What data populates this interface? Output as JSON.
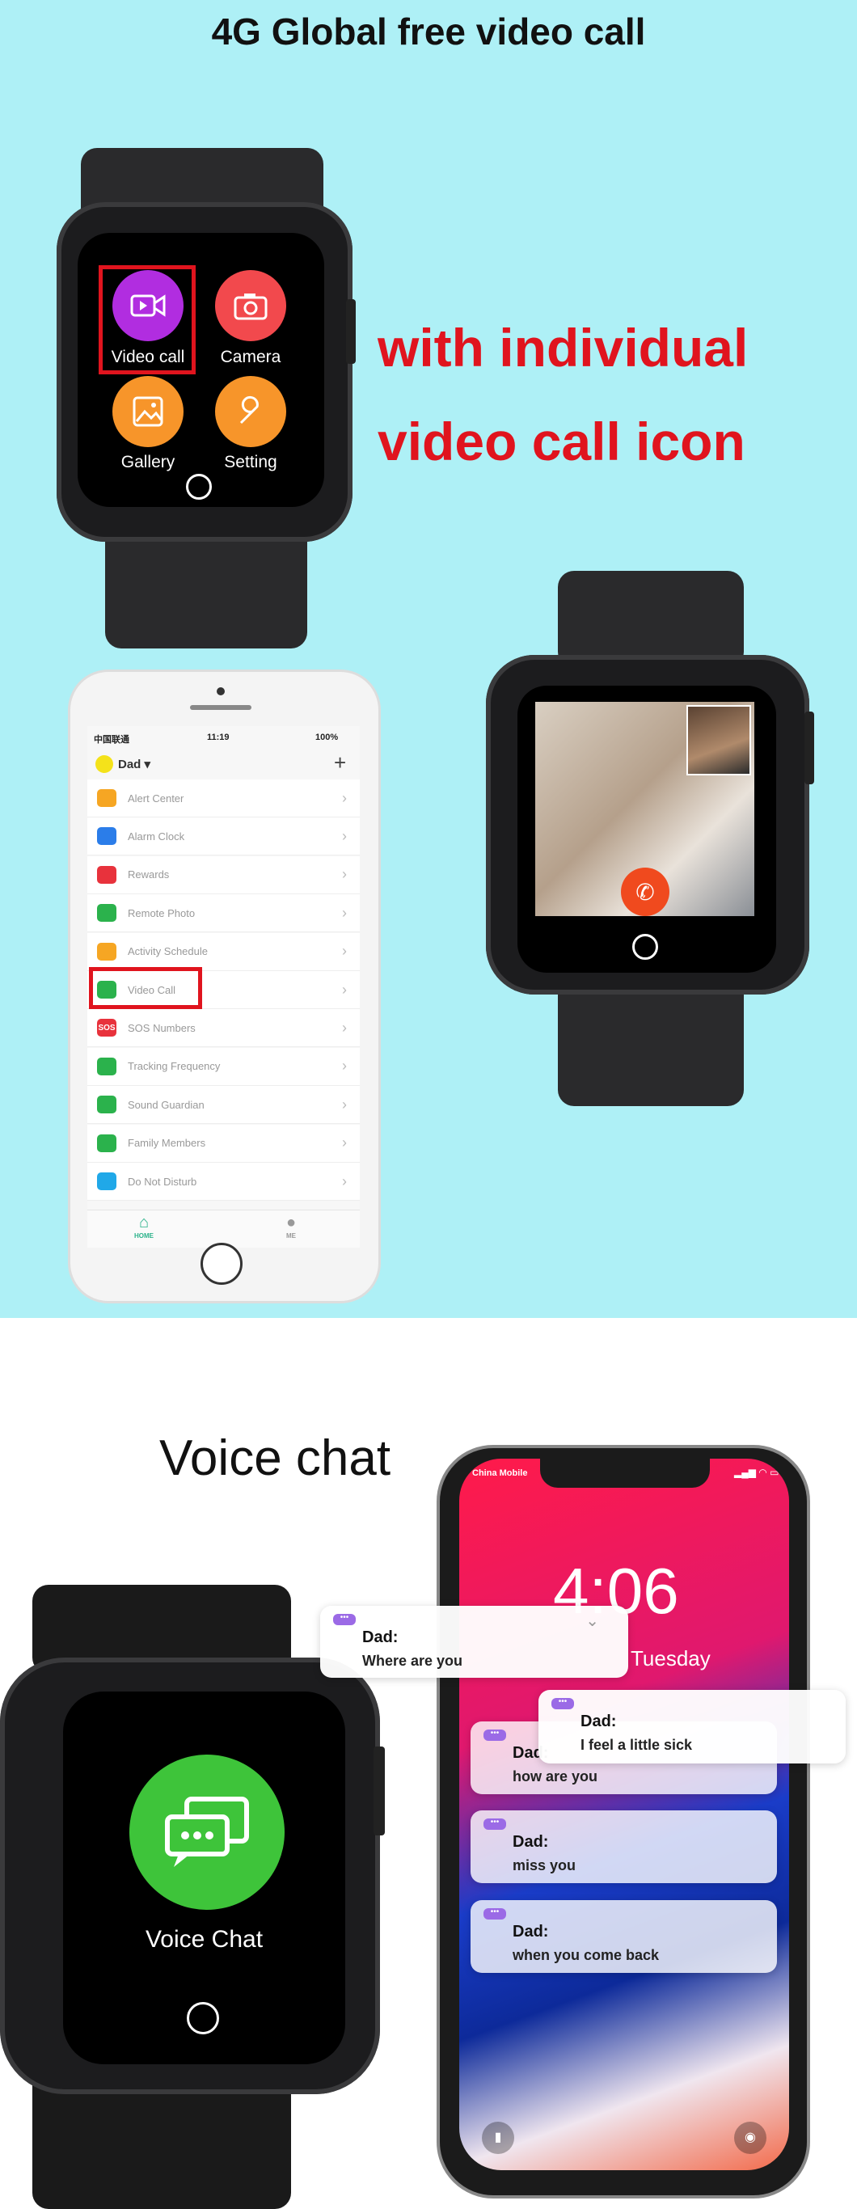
{
  "header": {
    "title": "4G Global free video call"
  },
  "tagline": {
    "line1": "with individual",
    "line2": "video call icon"
  },
  "watch_menu": {
    "apps": [
      {
        "label": "Video call",
        "icon": "video-camera-icon",
        "color": "#b12de0"
      },
      {
        "label": "Camera",
        "icon": "camera-icon",
        "color": "#f2494d"
      },
      {
        "label": "Gallery",
        "icon": "image-icon",
        "color": "#f7952a"
      },
      {
        "label": "Setting",
        "icon": "wrench-icon",
        "color": "#f7952a"
      }
    ]
  },
  "phone_app": {
    "status": {
      "carrier": "中国联通",
      "time": "11:19",
      "battery": "100%"
    },
    "profile": "Dad",
    "add_label": "+",
    "menu": [
      {
        "label": "Alert Center",
        "icon": "alert-icon",
        "color": "#f6a623"
      },
      {
        "label": "Alarm Clock",
        "icon": "alarm-clock-icon",
        "color": "#2b7de9"
      },
      {
        "label": "Rewards",
        "icon": "hearts-icon",
        "color": "#e8323c"
      },
      {
        "label": "Remote Photo",
        "icon": "camera-icon",
        "color": "#2bb24c"
      },
      {
        "label": "Activity Schedule",
        "icon": "schedule-icon",
        "color": "#f6a623"
      },
      {
        "label": "Video Call",
        "icon": "video-call-icon",
        "color": "#2bb24c"
      },
      {
        "label": "SOS Numbers",
        "icon": "sos-icon",
        "color": "#e8323c"
      },
      {
        "label": "Tracking Frequency",
        "icon": "tracking-icon",
        "color": "#2bb24c"
      },
      {
        "label": "Sound Guardian",
        "icon": "shield-phone-icon",
        "color": "#2bb24c"
      },
      {
        "label": "Family Members",
        "icon": "family-icon",
        "color": "#2bb24c"
      },
      {
        "label": "Do Not Disturb",
        "icon": "mute-icon",
        "color": "#20a8e8"
      }
    ],
    "sos_badge": "SOS",
    "nav": [
      {
        "label": "HOME",
        "icon": "home-icon",
        "color": "#2bb28a"
      },
      {
        "label": "ME",
        "icon": "person-icon",
        "color": "#999"
      }
    ]
  },
  "voice": {
    "title": "Voice chat",
    "watch_label": "Voice Chat",
    "lock_screen": {
      "carrier": "China Mobile",
      "time": "4:06",
      "day": "Tuesday"
    },
    "messages": [
      {
        "sender": "Dad:",
        "text": "Where are you"
      },
      {
        "sender": "Dad:",
        "text": "I feel a little sick"
      },
      {
        "sender": "Dad:",
        "text": "how are you"
      },
      {
        "sender": "Dad:",
        "text": "miss you"
      },
      {
        "sender": "Dad:",
        "text": "when you come back"
      }
    ],
    "dots": "•••"
  }
}
